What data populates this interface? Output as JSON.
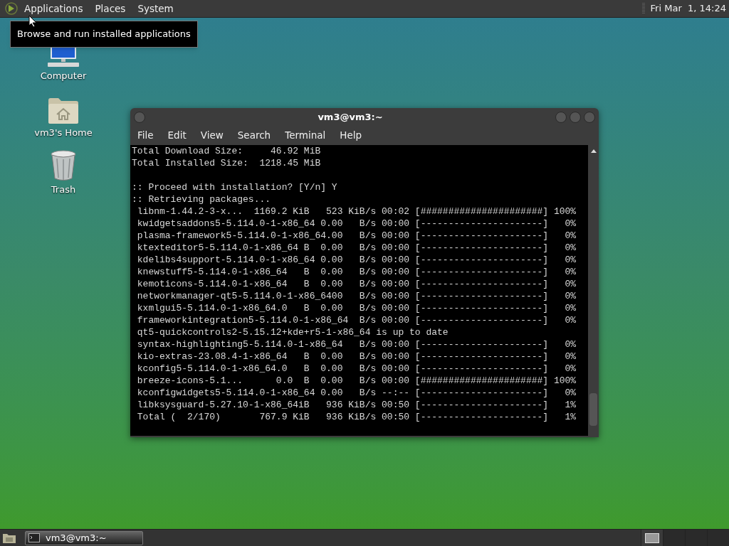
{
  "top_panel": {
    "menus": [
      {
        "label": "Applications"
      },
      {
        "label": "Places"
      },
      {
        "label": "System"
      }
    ],
    "clock": "Fri Mar  1, 14:24"
  },
  "tooltip": "Browse and run installed applications",
  "desktop_icons": [
    {
      "label": "Computer",
      "kind": "computer"
    },
    {
      "label": "vm3's Home",
      "kind": "home"
    },
    {
      "label": "Trash",
      "kind": "trash"
    }
  ],
  "window": {
    "title": "vm3@vm3:~",
    "menu": [
      "File",
      "Edit",
      "View",
      "Search",
      "Terminal",
      "Help"
    ],
    "terminal": {
      "blocks": [
        [
          "Total Download Size:     46.92 MiB",
          "Total Installed Size:  1218.45 MiB"
        ],
        [
          ":: Proceed with installation? [Y/n] Y",
          ":: Retrieving packages...",
          " libnm-1.44.2-3-x...  1169.2 KiB   523 KiB/s 00:02 [######################] 100%",
          " kwidgetsaddons5-5.114.0-1-x86_64 0.00   B/s 00:00 [----------------------]   0%",
          " plasma-framework5-5.114.0-1-x86_64.00   B/s 00:00 [----------------------]   0%",
          " ktexteditor5-5.114.0-1-x86_64 B  0.00   B/s 00:00 [----------------------]   0%",
          " kdelibs4support-5.114.0-1-x86_64 0.00   B/s 00:00 [----------------------]   0%",
          " knewstuff5-5.114.0-1-x86_64   B  0.00   B/s 00:00 [----------------------]   0%",
          " kemoticons-5.114.0-1-x86_64   B  0.00   B/s 00:00 [----------------------]   0%",
          " networkmanager-qt5-5.114.0-1-x86_6400   B/s 00:00 [----------------------]   0%",
          " kxmlgui5-5.114.0-1-x86_64.0   B  0.00   B/s 00:00 [----------------------]   0%",
          " frameworkintegration5-5.114.0-1-x86_64  B/s 00:00 [----------------------]   0%",
          " qt5-quickcontrols2-5.15.12+kde+r5-1-x86_64 is up to date",
          " syntax-highlighting5-5.114.0-1-x86_64   B/s 00:00 [----------------------]   0%",
          " kio-extras-23.08.4-1-x86_64   B  0.00   B/s 00:00 [----------------------]   0%",
          " kconfig5-5.114.0-1-x86_64.0   B  0.00   B/s 00:00 [----------------------]   0%",
          " breeze-icons-5.1...      0.0  B  0.00   B/s 00:00 [######################] 100%",
          " kconfigwidgets5-5.114.0-1-x86_64 0.00   B/s --:-- [----------------------]   0%",
          " libksysguard-5.27.10-1-x86_64iB   936 KiB/s 00:50 [----------------------]   1%",
          " Total (  2/170)       767.9 KiB   936 KiB/s 00:50 [----------------------]   1%"
        ]
      ]
    }
  },
  "taskbar": {
    "tasks": [
      {
        "label": "vm3@vm3:~",
        "selected": true
      }
    ],
    "workspaces": [
      {
        "selected": true
      },
      {
        "selected": false
      },
      {
        "selected": false
      },
      {
        "selected": false
      }
    ]
  }
}
